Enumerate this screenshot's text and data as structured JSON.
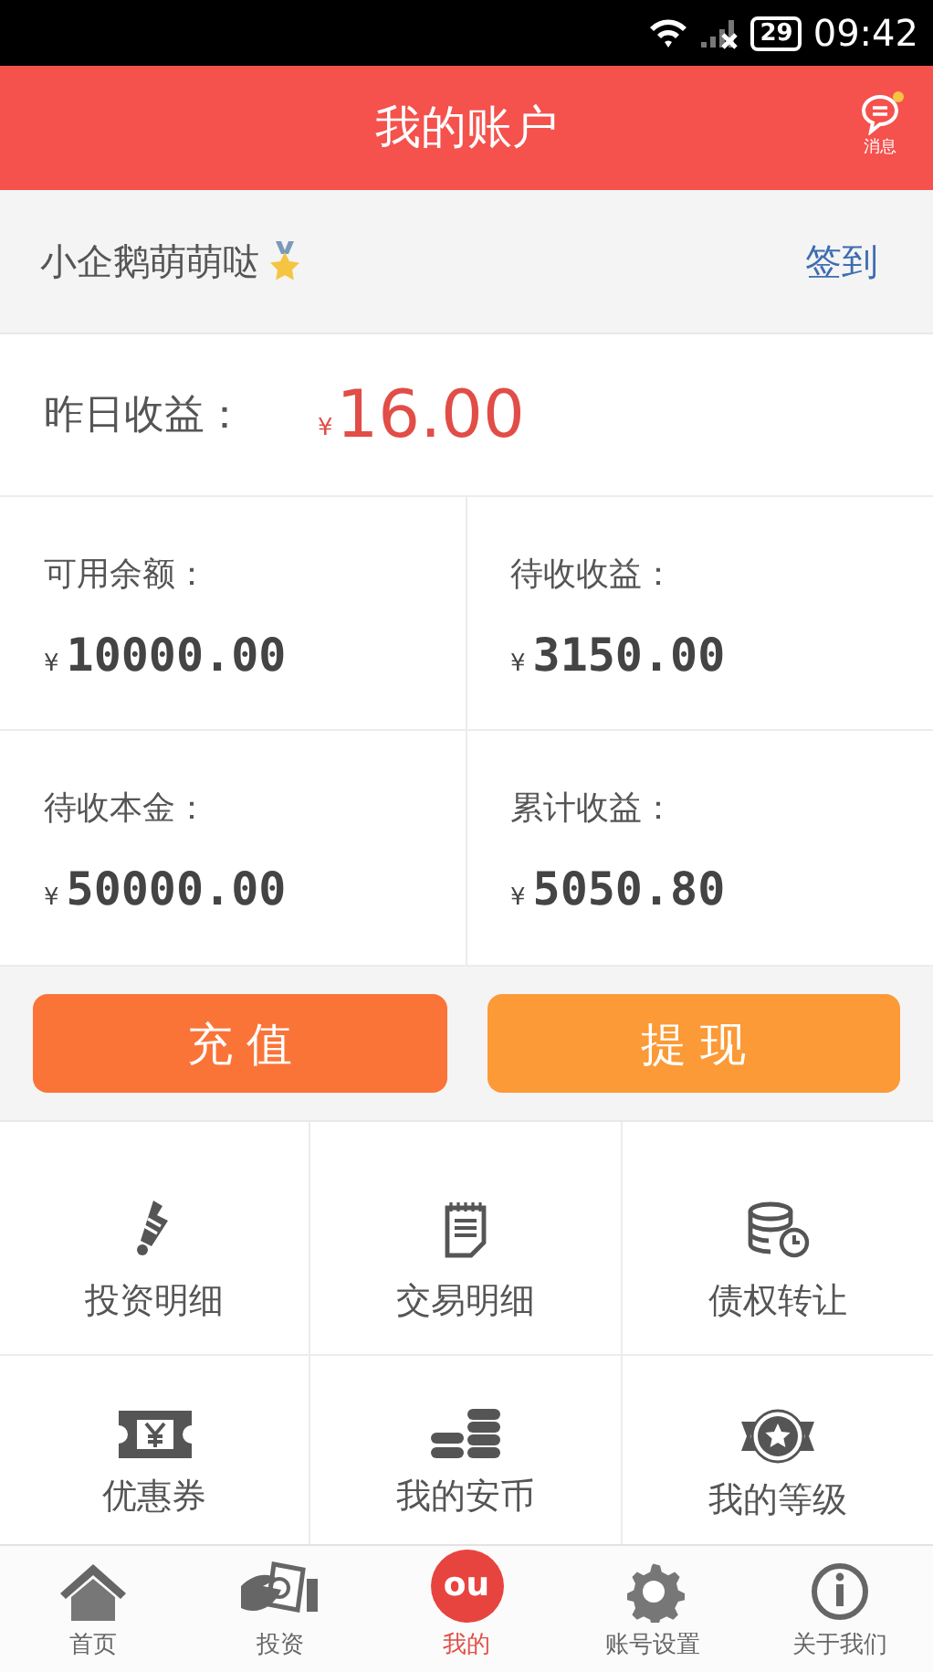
{
  "status_bar": {
    "battery": "29",
    "time": "09:42"
  },
  "header": {
    "title": "我的账户",
    "message_label": "消息",
    "message_unread": true
  },
  "user": {
    "name": "小企鹅萌萌哒",
    "sign_in": "签到"
  },
  "yesterday": {
    "label": "昨日收益：",
    "currency": "¥",
    "amount": "16.00"
  },
  "balances": [
    {
      "label": "可用余额：",
      "currency": "¥",
      "amount": "10000.00"
    },
    {
      "label": "待收收益：",
      "currency": "¥",
      "amount": "3150.00"
    },
    {
      "label": "待收本金：",
      "currency": "¥",
      "amount": "50000.00"
    },
    {
      "label": "累计收益：",
      "currency": "¥",
      "amount": "5050.80"
    }
  ],
  "actions": [
    {
      "label": "充 值",
      "kind": "recharge"
    },
    {
      "label": "提 现",
      "kind": "withdraw"
    }
  ],
  "menu": [
    {
      "label": "投资明细"
    },
    {
      "label": "交易明细"
    },
    {
      "label": "债权转让"
    },
    {
      "label": "优惠券"
    },
    {
      "label": "我的安币"
    },
    {
      "label": "我的等级"
    }
  ],
  "nav": [
    {
      "label": "首页",
      "selected": false
    },
    {
      "label": "投资",
      "selected": false
    },
    {
      "label": "我的",
      "selected": true,
      "badge": "ou"
    },
    {
      "label": "账号设置",
      "selected": false
    },
    {
      "label": "关于我们",
      "selected": false
    }
  ]
}
